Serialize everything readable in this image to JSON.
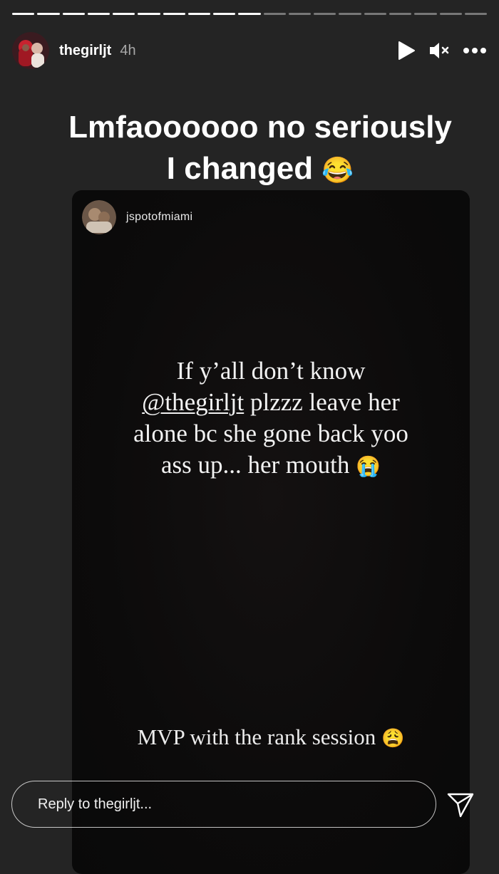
{
  "story": {
    "segments_total": 19,
    "segments_viewed": 10,
    "username": "thegirljt",
    "time_ago": "4h"
  },
  "caption": {
    "line1": "Lmfaoooooo no seriously",
    "line2": "I changed",
    "emoji": "😂"
  },
  "repost": {
    "username": "jspotofmiami",
    "body": {
      "line1": "If y’all don’t know",
      "mention": "@thegirljt",
      "line2_rest": " plzzz leave her",
      "line3": "alone bc she gone back yoo",
      "line4": "ass up... her mouth ",
      "line4_emoji": "😭"
    },
    "footer": "MVP with the rank session ",
    "footer_emoji": "😩"
  },
  "reply": {
    "placeholder": "Reply to thegirljt..."
  },
  "icons": {
    "play": "play-icon",
    "mute": "speaker-muted-icon",
    "more": "more-options-icon",
    "send": "send-icon"
  }
}
